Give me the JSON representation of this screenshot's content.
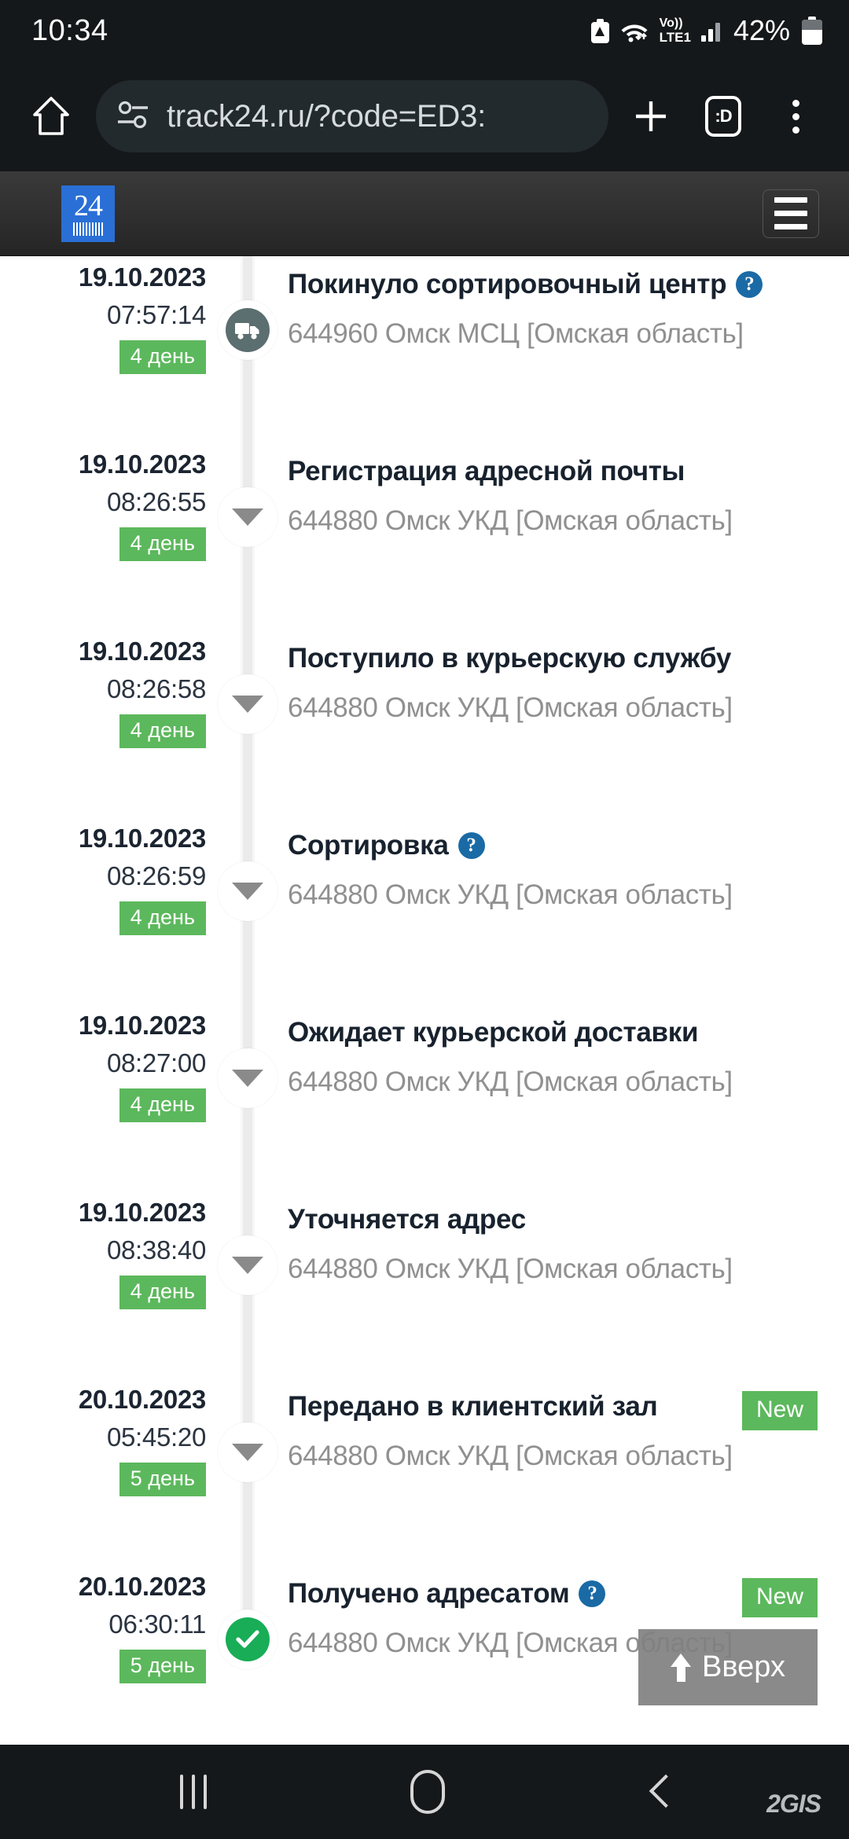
{
  "statusbar": {
    "clock": "10:34",
    "battery_percent": "42%",
    "network_voice": "Vo))",
    "network_type": "LTE1",
    "icons": [
      "battery-saver-icon",
      "wifi-icon",
      "volte-icon",
      "signal-bars-icon",
      "battery-icon"
    ]
  },
  "browser": {
    "home_label": "home-icon",
    "permission_icon": "site-permissions-icon",
    "url": "track24.ru/?code=ED3:",
    "new_tab_label": "+",
    "tab_count": ":D",
    "menu_label": "more-options"
  },
  "site_header": {
    "logo_number": "24",
    "menu_label": "menu"
  },
  "timeline": {
    "events": [
      {
        "date": "19.10.2023",
        "time": "07:57:14",
        "day_badge": "4 день",
        "title": "Покинуло сортировочный центр",
        "has_help": true,
        "place": "644960 Омск МСЦ [Омская область]",
        "marker": "truck",
        "new_badge": ""
      },
      {
        "date": "19.10.2023",
        "time": "08:26:55",
        "day_badge": "4 день",
        "title": "Регистрация адресной почты",
        "has_help": false,
        "place": "644880 Омск УКД [Омская область]",
        "marker": "arrow",
        "new_badge": ""
      },
      {
        "date": "19.10.2023",
        "time": "08:26:58",
        "day_badge": "4 день",
        "title": "Поступило в курьерскую службу",
        "has_help": false,
        "place": "644880 Омск УКД [Омская область]",
        "marker": "arrow",
        "new_badge": ""
      },
      {
        "date": "19.10.2023",
        "time": "08:26:59",
        "day_badge": "4 день",
        "title": "Сортировка",
        "has_help": true,
        "place": "644880 Омск УКД [Омская область]",
        "marker": "arrow",
        "new_badge": ""
      },
      {
        "date": "19.10.2023",
        "time": "08:27:00",
        "day_badge": "4 день",
        "title": "Ожидает курьерской доставки",
        "has_help": false,
        "place": "644880 Омск УКД [Омская область]",
        "marker": "arrow",
        "new_badge": ""
      },
      {
        "date": "19.10.2023",
        "time": "08:38:40",
        "day_badge": "4 день",
        "title": "Уточняется адрес",
        "has_help": false,
        "place": "644880 Омск УКД [Омская область]",
        "marker": "arrow",
        "new_badge": ""
      },
      {
        "date": "20.10.2023",
        "time": "05:45:20",
        "day_badge": "5 день",
        "title": "Передано в клиентский зал",
        "has_help": false,
        "place": "644880 Омск УКД [Омская область]",
        "marker": "arrow",
        "new_badge": "New"
      },
      {
        "date": "20.10.2023",
        "time": "06:30:11",
        "day_badge": "5 день",
        "title": "Получено адресатом",
        "has_help": true,
        "place": "644880 Омск УКД [Омская область]",
        "marker": "done",
        "new_badge": "New"
      }
    ],
    "help_glyph": "?"
  },
  "scroll_top_button": {
    "label": "Вверх"
  },
  "navbar": {
    "recents_label": "recent-apps",
    "home_label": "home",
    "back_label": "back",
    "watermark": "2GIS"
  },
  "colors": {
    "green_badge": "#5cb85c",
    "green_done": "#18ad56",
    "help_blue": "#1a6aa5",
    "logo_blue": "#2a6fd6",
    "status_bg": "#15181a"
  }
}
